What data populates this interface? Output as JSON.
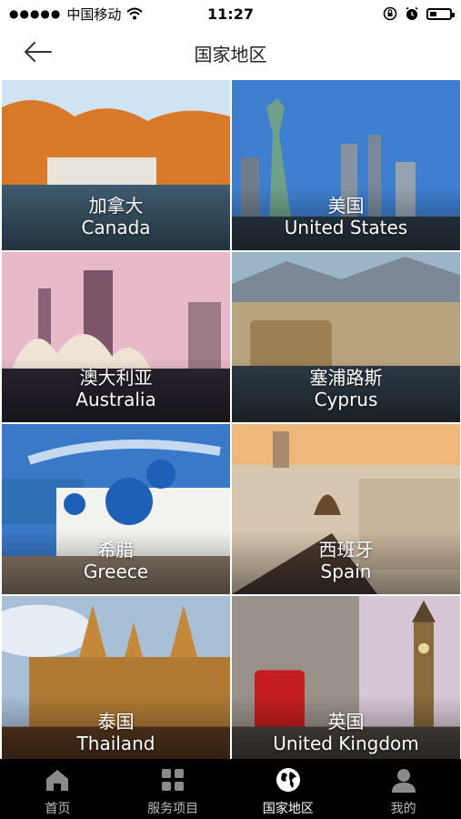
{
  "status_bar": {
    "carrier": "中国移动",
    "time": "11:27",
    "battery_level": 0.35
  },
  "nav": {
    "title": "国家地区",
    "back_icon": "arrow-left-icon"
  },
  "countries": [
    {
      "zh": "加拿大",
      "en": "Canada",
      "colors": [
        "#cfe3f5",
        "#d97a2b",
        "#3e5b6e"
      ]
    },
    {
      "zh": "美国",
      "en": "United States",
      "colors": [
        "#3e7fd0",
        "#6ea08a",
        "#2d3a48"
      ]
    },
    {
      "zh": "澳大利亚",
      "en": "Australia",
      "colors": [
        "#e8b9c8",
        "#b37390",
        "#2a2430"
      ]
    },
    {
      "zh": "塞浦路斯",
      "en": "Cyprus",
      "colors": [
        "#9cb4c8",
        "#b9a480",
        "#2e3b46"
      ]
    },
    {
      "zh": "希腊",
      "en": "Greece",
      "colors": [
        "#3a78c8",
        "#f2f2ee",
        "#1e5fb8"
      ]
    },
    {
      "zh": "西班牙",
      "en": "Spain",
      "colors": [
        "#f0b77a",
        "#d8c7b0",
        "#4a3a30"
      ]
    },
    {
      "zh": "泰国",
      "en": "Thailand",
      "colors": [
        "#a8bfd8",
        "#c48a3a",
        "#5b3a20"
      ]
    },
    {
      "zh": "英国",
      "en": "United Kingdom",
      "colors": [
        "#d7c7d6",
        "#c41e1e",
        "#4a4540"
      ]
    }
  ],
  "tabs": [
    {
      "label": "首页",
      "icon": "home-icon"
    },
    {
      "label": "服务项目",
      "icon": "grid-icon"
    },
    {
      "label": "国家地区",
      "icon": "globe-icon",
      "active": true
    },
    {
      "label": "我的",
      "icon": "user-icon"
    }
  ]
}
